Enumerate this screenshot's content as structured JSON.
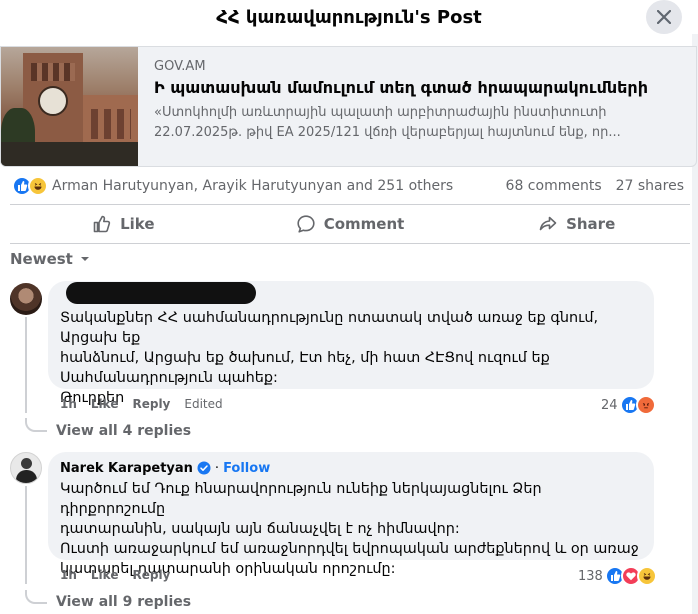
{
  "header": {
    "title": "ՀՀ կառավարություն's Post"
  },
  "link_card": {
    "domain": "GOV.AM",
    "headline": "Ի պատասխան մամուլում տեղ գտած հրապարակումների",
    "description": "«Ստոկհոլմի առևտրային պալատի արբիտրաժային ինստիտուտի 22.07.2025թ. թիվ EA 2025/121 վճռի վերաբերյալ հայտնում ենք, որ..."
  },
  "post_stats": {
    "reactors": "Arman Harutyunyan, Arayik Harutyunyan and 251 others",
    "comments": "68 comments",
    "shares": "27 shares",
    "reaction_icons": [
      "like-icon",
      "haha-icon"
    ]
  },
  "actions": {
    "like": "Like",
    "comment": "Comment",
    "share": "Share"
  },
  "sort": {
    "label": "Newest"
  },
  "comments": [
    {
      "author": "",
      "lines": [
        "Տականքներ ՀՀ սահմանադրությունը ոտատակ տված առաջ եք գնում, Արցախ եք",
        "հանձնում, Արցախ եք ծախում, Էտ հեչ, մի հատ ՀԷՑով ուզում եք",
        "Սահմանադրություն պահեք:",
        "Թուրքեր"
      ],
      "time": "1h",
      "like": "Like",
      "reply": "Reply",
      "edited": "Edited",
      "reaction_count": "24",
      "reaction_icons": [
        "like-icon",
        "angry-icon"
      ],
      "view_replies": "View all 4 replies"
    },
    {
      "author": "Narek Karapetyan",
      "follow": "Follow",
      "separator": "·",
      "lines": [
        "Կարծում եմ Դուք հնարավորություն ունեիք ներկայացնելու Ձեր դիրքորոշումը",
        "դատարանին, սակայն այն ճանաչվել է ոչ հիմնավոր:",
        "Ուստի առաջարկում եմ առաջնորդվել եվրոպական արժեքներով և օր առաջ",
        "կատարել դատարանի օրինական որոշումը:"
      ],
      "time": "1h",
      "like": "Like",
      "reply": "Reply",
      "reaction_count": "138",
      "reaction_icons": [
        "like-icon",
        "love-icon",
        "haha-icon"
      ],
      "view_replies": "View all 9 replies"
    }
  ],
  "colors": {
    "accent": "#1877f2",
    "muted": "#65676b",
    "bubble": "#f0f2f5"
  }
}
